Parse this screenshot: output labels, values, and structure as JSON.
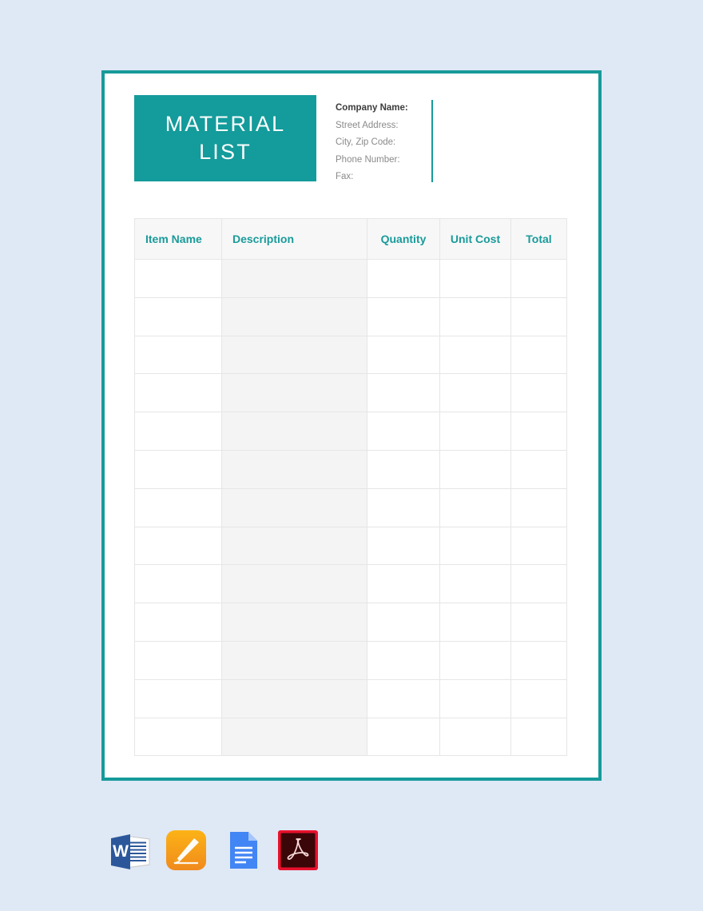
{
  "background_color": "#dfe8f5",
  "accent_color": "#149b9b",
  "document": {
    "title_lines": [
      "MATERIAL",
      "LIST"
    ],
    "company_info": {
      "fields": [
        {
          "label": "Company Name:",
          "emphasis": true
        },
        {
          "label": "Street Address:",
          "emphasis": false
        },
        {
          "label": "City, Zip Code:",
          "emphasis": false
        },
        {
          "label": "Phone Number:",
          "emphasis": false
        },
        {
          "label": "Fax:",
          "emphasis": false
        }
      ]
    },
    "table": {
      "columns": [
        {
          "key": "item_name",
          "label": "Item Name",
          "align": "left"
        },
        {
          "key": "description",
          "label": "Description",
          "align": "left"
        },
        {
          "key": "quantity",
          "label": "Quantity",
          "align": "center"
        },
        {
          "key": "unit_cost",
          "label": "Unit Cost",
          "align": "center"
        },
        {
          "key": "total",
          "label": "Total",
          "align": "center"
        }
      ],
      "row_count": 13,
      "rows": [
        {
          "item_name": "",
          "description": "",
          "quantity": "",
          "unit_cost": "",
          "total": ""
        },
        {
          "item_name": "",
          "description": "",
          "quantity": "",
          "unit_cost": "",
          "total": ""
        },
        {
          "item_name": "",
          "description": "",
          "quantity": "",
          "unit_cost": "",
          "total": ""
        },
        {
          "item_name": "",
          "description": "",
          "quantity": "",
          "unit_cost": "",
          "total": ""
        },
        {
          "item_name": "",
          "description": "",
          "quantity": "",
          "unit_cost": "",
          "total": ""
        },
        {
          "item_name": "",
          "description": "",
          "quantity": "",
          "unit_cost": "",
          "total": ""
        },
        {
          "item_name": "",
          "description": "",
          "quantity": "",
          "unit_cost": "",
          "total": ""
        },
        {
          "item_name": "",
          "description": "",
          "quantity": "",
          "unit_cost": "",
          "total": ""
        },
        {
          "item_name": "",
          "description": "",
          "quantity": "",
          "unit_cost": "",
          "total": ""
        },
        {
          "item_name": "",
          "description": "",
          "quantity": "",
          "unit_cost": "",
          "total": ""
        },
        {
          "item_name": "",
          "description": "",
          "quantity": "",
          "unit_cost": "",
          "total": ""
        },
        {
          "item_name": "",
          "description": "",
          "quantity": "",
          "unit_cost": "",
          "total": ""
        },
        {
          "item_name": "",
          "description": "",
          "quantity": "",
          "unit_cost": "",
          "total": ""
        }
      ]
    }
  },
  "formats": [
    {
      "icon": "ms-word-icon",
      "name": "MS Word"
    },
    {
      "icon": "apple-pages-icon",
      "name": "Apple Pages"
    },
    {
      "icon": "google-docs-icon",
      "name": "Google Docs"
    },
    {
      "icon": "adobe-pdf-icon",
      "name": "PDF"
    }
  ]
}
